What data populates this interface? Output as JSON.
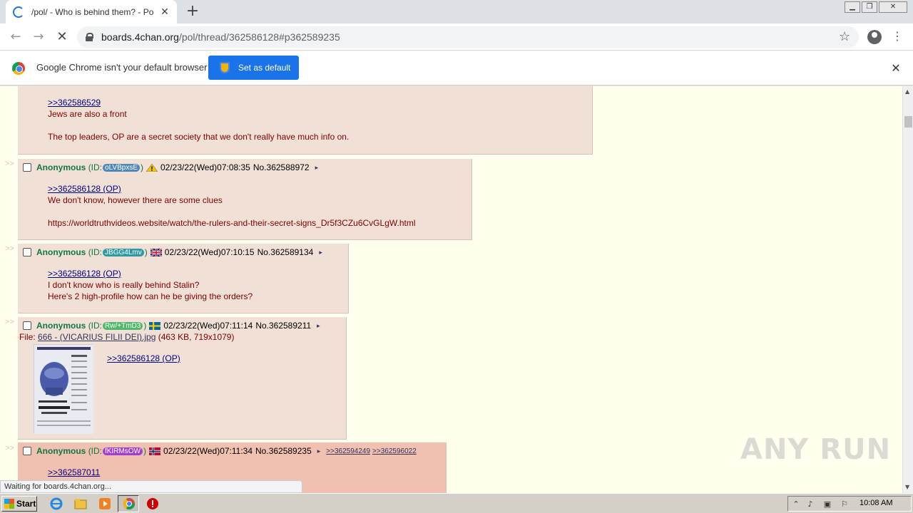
{
  "browser": {
    "tab_title": "/pol/ - Who is behind them? - Politica",
    "tab_close": "✕",
    "new_tab": "+",
    "url_host": "boards.4chan.org",
    "url_path": "/pol/thread/362586128#p362589235",
    "back": "←",
    "forward": "→",
    "stop": "✕",
    "star": "☆",
    "menu": "⋮",
    "win_min": "▁",
    "win_max": "❐",
    "win_close": "✕"
  },
  "infobar": {
    "message": "Google Chrome isn't your default browser",
    "button": "Set as default",
    "close": "✕"
  },
  "thread": {
    "arrows": ">>",
    "posts": [
      {
        "partial_top": true,
        "lines": [
          ">>362586529",
          "Jews are also a front",
          "",
          "The top leaders, OP are a secret society that we don't really have much info on."
        ]
      },
      {
        "name": "Anonymous",
        "id_prefix": "(ID: ",
        "id": "oLVBpxsE",
        "id_suffix": ")",
        "id_color": "#4f88b8",
        "flag": "warning",
        "datetime": "02/23/22(Wed)07:08:35",
        "number": "No.362588972",
        "menu": "▸",
        "lines": [
          ">>362586128 (OP)",
          "We don't know, however there are some clues",
          "",
          "https://worldtruthvideos.website/watch/the-rulers-and-their-secret-signs_Dr5f3CZu6CvGLgW.html"
        ]
      },
      {
        "name": "Anonymous",
        "id_prefix": "(ID: ",
        "id": "JBGG4Lmv",
        "id_suffix": ")",
        "id_color": "#2f9aa3",
        "flag": "uk",
        "datetime": "02/23/22(Wed)07:10:15",
        "number": "No.362589134",
        "menu": "▸",
        "lines": [
          ">>362586128 (OP)",
          "I don't know who is really behind Stalin?",
          "Here's 2 high-profile how can he be giving the orders?"
        ]
      },
      {
        "name": "Anonymous",
        "id_prefix": "(ID: ",
        "id": "Rw/+TmD3",
        "id_suffix": ")",
        "id_color": "#4fb86a",
        "flag": "sweden",
        "datetime": "02/23/22(Wed)07:11:14",
        "number": "No.362589211",
        "menu": "▸",
        "file_label": "File: ",
        "file_name": "666 - (VICARIUS FILII DEI).jpg",
        "file_meta": " (463 KB, 719x1079)",
        "lines": [
          ">>362586128 (OP)"
        ]
      },
      {
        "name": "Anonymous",
        "id_prefix": "(ID: ",
        "id": "fKIRMsOW",
        "id_suffix": ")",
        "id_color": "#a33fd0",
        "flag": "norway",
        "datetime": "02/23/22(Wed)07:11:34",
        "number": "No.362589235",
        "menu": "▸",
        "backlinks": [
          ">>362594249",
          ">>362596022"
        ],
        "lines": [
          ">>362587011"
        ]
      }
    ]
  },
  "status": "Waiting for boards.4chan.org...",
  "watermark": "ANY RUN",
  "taskbar": {
    "start": "Start",
    "clock": "10:08 AM"
  }
}
